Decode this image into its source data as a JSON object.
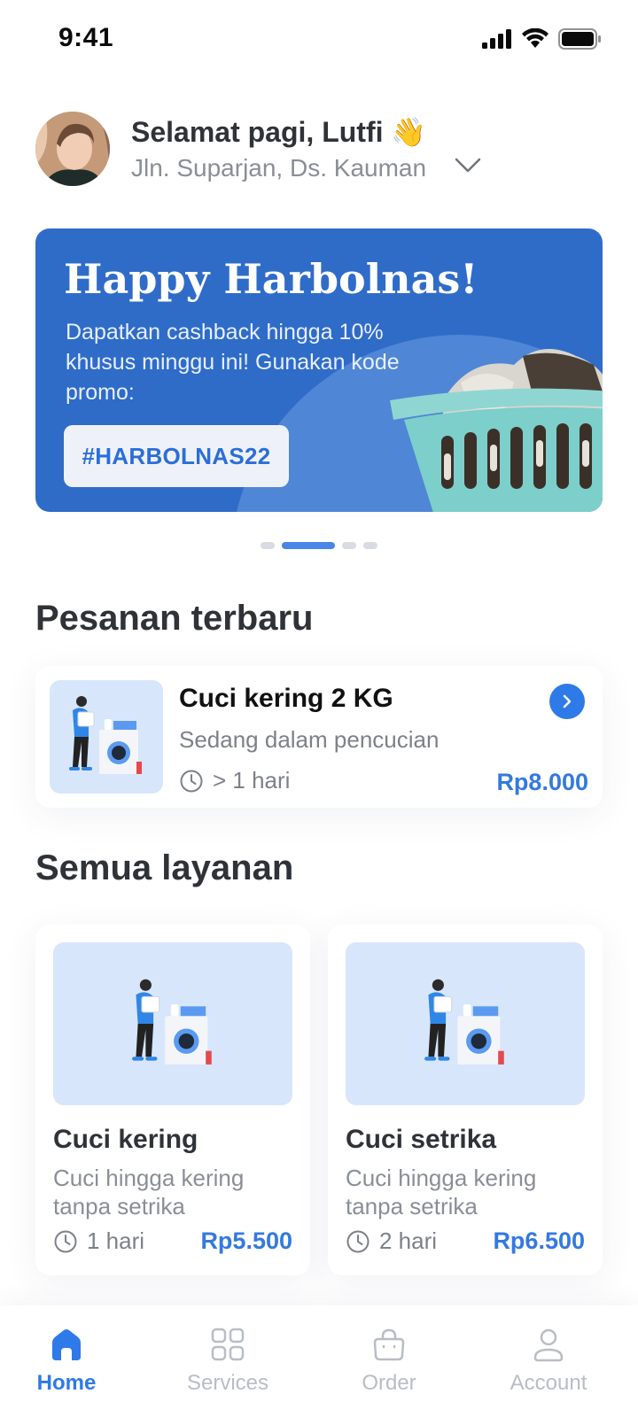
{
  "status_bar": {
    "time": "9:41"
  },
  "header": {
    "greeting": "Selamat pagi, Lutfi 👋",
    "address": "Jln. Suparjan, Ds. Kauman"
  },
  "banner": {
    "title": "Happy Harbolnas!",
    "text": "Dapatkan cashback hingga 10% khusus minggu ini! Gunakan kode promo:",
    "promo_code": "#HARBOLNAS22",
    "page_count": 4,
    "active_page": 2
  },
  "recent_orders": {
    "title": "Pesanan terbaru",
    "items": [
      {
        "name": "Cuci kering 2 KG",
        "status": "Sedang dalam pencucian",
        "duration": "> 1 hari",
        "price": "Rp8.000"
      }
    ]
  },
  "services": {
    "title": "Semua layanan",
    "items": [
      {
        "name": "Cuci kering",
        "description": "Cuci hingga kering tanpa setrika",
        "duration": "1 hari",
        "price": "Rp5.500"
      },
      {
        "name": "Cuci setrika",
        "description": "Cuci hingga kering tanpa setrika",
        "duration": "2 hari",
        "price": "Rp6.500"
      }
    ]
  },
  "bottom_nav": {
    "items": [
      {
        "label": "Home",
        "icon": "home-icon",
        "active": true
      },
      {
        "label": "Services",
        "icon": "grid-icon",
        "active": false
      },
      {
        "label": "Order",
        "icon": "bag-icon",
        "active": false
      },
      {
        "label": "Account",
        "icon": "user-icon",
        "active": false
      }
    ]
  },
  "colors": {
    "accent": "#2e7ae8",
    "banner_bg": "#2f6cc8",
    "card_thumb_bg": "#d8e6fb",
    "price": "#3479e0"
  }
}
